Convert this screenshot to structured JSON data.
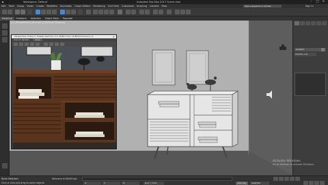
{
  "titlebar": {
    "quick_access": "Workspace: Default",
    "app_title": "Autodesk 3ds Max 2017    Scene.max",
    "search_placeholder": "Type a keyword or phrase",
    "minimize": "–",
    "maximize": "□",
    "close": "×"
  },
  "menubar": {
    "items": [
      "Edit",
      "Tools",
      "Group",
      "Views",
      "Create",
      "Modifiers",
      "Animation",
      "Graph Editors",
      "Rendering",
      "Civil View",
      "Customize",
      "Scripting",
      "Content",
      "Help"
    ],
    "sign_in": "Sign In"
  },
  "ribbon": {
    "tabs": [
      "Modeling",
      "Freeform",
      "Selection",
      "Object Paint",
      "Populate"
    ],
    "active_index": 0
  },
  "viewport": {
    "label": "[+] [Perspective] [Standard] [Default Shading]"
  },
  "render_frame": {
    "title": "Perspective, frame 0, Display Gamma: 2.2, RGBA Color 16 Bits/Channel (1:1)",
    "area_to_render_label": "Area to Render:",
    "area_to_render_value": "View",
    "close": "×"
  },
  "command_panel": {
    "object_name": "Line001",
    "modifier_list": "Modifier List"
  },
  "statusbar": {
    "selection": "None Selected",
    "prompt": "Click or click-and-drag to select objects",
    "welcome": "Welcome to MAXScript.",
    "x_label": "X:",
    "y_label": "Y:",
    "z_label": "Z:",
    "grid": "Grid = 10.0",
    "autokey": "Auto Key",
    "selected": "Selected"
  },
  "watermark": {
    "line1": "Activate Windows",
    "line2": "Go to Settings to activate Windows."
  },
  "colors": {
    "ui_bg": "#2b2b2b",
    "viewport_bg": "#5f5f5f",
    "accent_blue": "#4f88c6"
  }
}
